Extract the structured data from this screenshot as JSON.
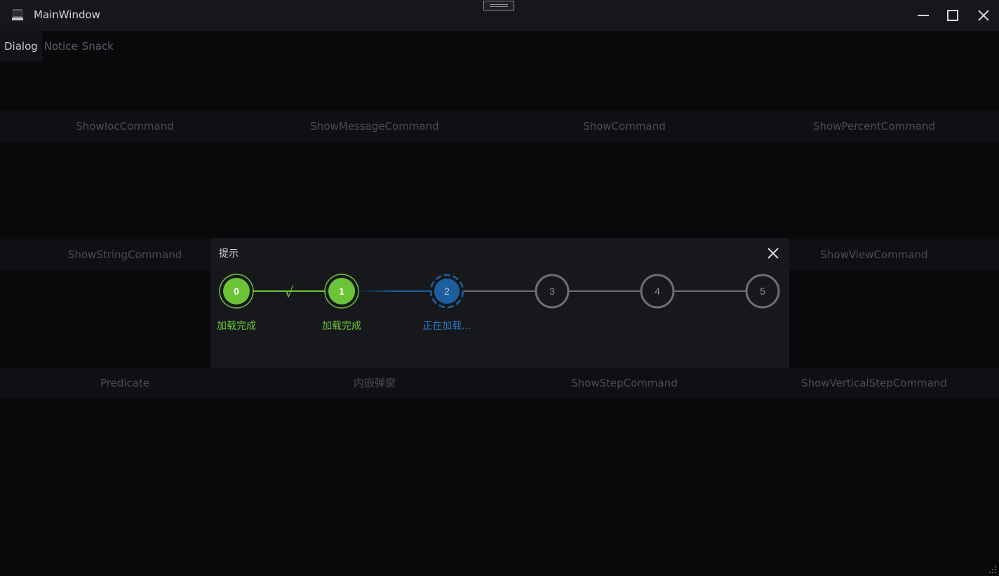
{
  "window": {
    "title": "MainWindow",
    "icons": {
      "app": "window-app-icon",
      "minimize": "minimize-icon",
      "maximize": "maximize-icon",
      "close": "close-icon"
    }
  },
  "tabs": [
    {
      "label": "Dialog",
      "active": true
    },
    {
      "label": "Notice",
      "active": false
    },
    {
      "label": "Snack",
      "active": false
    }
  ],
  "rows": [
    [
      "ShowIocCommand",
      "ShowMessageCommand",
      "ShowCommand",
      "ShowPercentCommand"
    ],
    [
      "ShowStringCommand",
      "",
      "",
      "ShowViewCommand"
    ],
    [
      "Predicate",
      "内嵌弹窗",
      "ShowStepCommand",
      "ShowVerticalStepCommand"
    ]
  ],
  "dialog": {
    "title": "提示",
    "close_icon": "close-icon",
    "checkmark": "√",
    "steps": [
      {
        "number": "0",
        "status": "done",
        "label": "加载完成"
      },
      {
        "number": "1",
        "status": "done",
        "label": "加载完成"
      },
      {
        "number": "2",
        "status": "active",
        "label": "正在加载..."
      },
      {
        "number": "3",
        "status": "pending",
        "label": ""
      },
      {
        "number": "4",
        "status": "pending",
        "label": ""
      },
      {
        "number": "5",
        "status": "pending",
        "label": ""
      }
    ],
    "colors": {
      "done": "#6bc437",
      "active": "#1c5f9e",
      "pending": "#6e6e72",
      "done_text": "#6bc437",
      "active_text": "#2a74bc"
    }
  }
}
